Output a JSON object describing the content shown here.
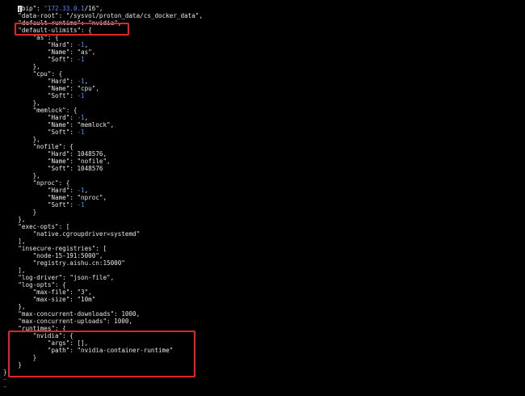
{
  "editor": {
    "lines": [
      {
        "parts": [
          {
            "t": "    "
          },
          {
            "t": "\"bip\"",
            "c": "k"
          },
          {
            "t": ": "
          },
          {
            "t": "\"172.33.0.1",
            "c": "n"
          },
          {
            "t": "/16\",",
            "c": "s"
          }
        ]
      },
      {
        "parts": [
          {
            "t": "    "
          },
          {
            "t": "\"data-root\"",
            "c": "k"
          },
          {
            "t": ": "
          },
          {
            "t": "\"/sysvol/proton_data/cs_docker_data\",",
            "c": "s"
          }
        ]
      },
      {
        "parts": [
          {
            "t": "    "
          },
          {
            "t": "\"default-runtime\"",
            "c": "k"
          },
          {
            "t": ": "
          },
          {
            "t": "\"nvidia\",",
            "c": "s"
          }
        ]
      },
      {
        "parts": [
          {
            "t": "    "
          },
          {
            "t": "\"default-ulimits\"",
            "c": "k"
          },
          {
            "t": ": {"
          }
        ]
      },
      {
        "parts": [
          {
            "t": "        "
          },
          {
            "t": "\"as\"",
            "c": "k"
          },
          {
            "t": ": {"
          }
        ]
      },
      {
        "parts": [
          {
            "t": "            "
          },
          {
            "t": "\"Hard\"",
            "c": "k"
          },
          {
            "t": ": "
          },
          {
            "t": "-1",
            "c": "n"
          },
          {
            "t": ","
          }
        ]
      },
      {
        "parts": [
          {
            "t": "            "
          },
          {
            "t": "\"Name\"",
            "c": "k"
          },
          {
            "t": ": "
          },
          {
            "t": "\"as\",",
            "c": "s"
          }
        ]
      },
      {
        "parts": [
          {
            "t": "            "
          },
          {
            "t": "\"Soft\"",
            "c": "k"
          },
          {
            "t": ": "
          },
          {
            "t": "-1",
            "c": "n"
          }
        ]
      },
      {
        "parts": [
          {
            "t": "        },"
          }
        ]
      },
      {
        "parts": [
          {
            "t": "        "
          },
          {
            "t": "\"cpu\"",
            "c": "k"
          },
          {
            "t": ": {"
          }
        ]
      },
      {
        "parts": [
          {
            "t": "            "
          },
          {
            "t": "\"Hard\"",
            "c": "k"
          },
          {
            "t": ": "
          },
          {
            "t": "-1",
            "c": "n"
          },
          {
            "t": ","
          }
        ]
      },
      {
        "parts": [
          {
            "t": "            "
          },
          {
            "t": "\"Name\"",
            "c": "k"
          },
          {
            "t": ": "
          },
          {
            "t": "\"cpu\",",
            "c": "s"
          }
        ]
      },
      {
        "parts": [
          {
            "t": "            "
          },
          {
            "t": "\"Soft\"",
            "c": "k"
          },
          {
            "t": ": "
          },
          {
            "t": "-1",
            "c": "n"
          }
        ]
      },
      {
        "parts": [
          {
            "t": "        },"
          }
        ]
      },
      {
        "parts": [
          {
            "t": "        "
          },
          {
            "t": "\"memlock\"",
            "c": "k"
          },
          {
            "t": ": {"
          }
        ]
      },
      {
        "parts": [
          {
            "t": "            "
          },
          {
            "t": "\"Hard\"",
            "c": "k"
          },
          {
            "t": ": "
          },
          {
            "t": "-1",
            "c": "n"
          },
          {
            "t": ","
          }
        ]
      },
      {
        "parts": [
          {
            "t": "            "
          },
          {
            "t": "\"Name\"",
            "c": "k"
          },
          {
            "t": ": "
          },
          {
            "t": "\"memlock\",",
            "c": "s"
          }
        ]
      },
      {
        "parts": [
          {
            "t": "            "
          },
          {
            "t": "\"Soft\"",
            "c": "k"
          },
          {
            "t": ": "
          },
          {
            "t": "-1",
            "c": "n"
          }
        ]
      },
      {
        "parts": [
          {
            "t": "        },"
          }
        ]
      },
      {
        "parts": [
          {
            "t": "        "
          },
          {
            "t": "\"nofile\"",
            "c": "k"
          },
          {
            "t": ": {"
          }
        ]
      },
      {
        "parts": [
          {
            "t": "            "
          },
          {
            "t": "\"Hard\"",
            "c": "k"
          },
          {
            "t": ": "
          },
          {
            "t": "1048576",
            "c": "d"
          },
          {
            "t": ","
          }
        ]
      },
      {
        "parts": [
          {
            "t": "            "
          },
          {
            "t": "\"Name\"",
            "c": "k"
          },
          {
            "t": ": "
          },
          {
            "t": "\"nofile\",",
            "c": "s"
          }
        ]
      },
      {
        "parts": [
          {
            "t": "            "
          },
          {
            "t": "\"Soft\"",
            "c": "k"
          },
          {
            "t": ": "
          },
          {
            "t": "1048576",
            "c": "d"
          }
        ]
      },
      {
        "parts": [
          {
            "t": "        },"
          }
        ]
      },
      {
        "parts": [
          {
            "t": "        "
          },
          {
            "t": "\"nproc\"",
            "c": "k"
          },
          {
            "t": ": {"
          }
        ]
      },
      {
        "parts": [
          {
            "t": "            "
          },
          {
            "t": "\"Hard\"",
            "c": "k"
          },
          {
            "t": ": "
          },
          {
            "t": "-1",
            "c": "n"
          },
          {
            "t": ","
          }
        ]
      },
      {
        "parts": [
          {
            "t": "            "
          },
          {
            "t": "\"Name\"",
            "c": "k"
          },
          {
            "t": ": "
          },
          {
            "t": "\"nproc\",",
            "c": "s"
          }
        ]
      },
      {
        "parts": [
          {
            "t": "            "
          },
          {
            "t": "\"Soft\"",
            "c": "k"
          },
          {
            "t": ": "
          },
          {
            "t": "-1",
            "c": "n"
          }
        ]
      },
      {
        "parts": [
          {
            "t": "        }"
          }
        ]
      },
      {
        "parts": [
          {
            "t": "    },"
          }
        ]
      },
      {
        "parts": [
          {
            "t": "    "
          },
          {
            "t": "\"exec-opts\"",
            "c": "k"
          },
          {
            "t": ": ["
          }
        ]
      },
      {
        "parts": [
          {
            "t": "        "
          },
          {
            "t": "\"native.cgroupdriver=systemd\"",
            "c": "s"
          }
        ]
      },
      {
        "parts": [
          {
            "t": "    ],"
          }
        ]
      },
      {
        "parts": [
          {
            "t": "    "
          },
          {
            "t": "\"insecure-registries\"",
            "c": "k"
          },
          {
            "t": ": ["
          }
        ]
      },
      {
        "parts": [
          {
            "t": "        "
          },
          {
            "t": "\"node-15-191:5000\",",
            "c": "s"
          }
        ]
      },
      {
        "parts": [
          {
            "t": "        "
          },
          {
            "t": "\"registry.aishu.cn:15000\"",
            "c": "s"
          }
        ]
      },
      {
        "parts": [
          {
            "t": "    ],"
          }
        ]
      },
      {
        "parts": [
          {
            "t": "    "
          },
          {
            "t": "\"log-driver\"",
            "c": "k"
          },
          {
            "t": ": "
          },
          {
            "t": "\"json-file\",",
            "c": "s"
          }
        ]
      },
      {
        "parts": [
          {
            "t": "    "
          },
          {
            "t": "\"log-opts\"",
            "c": "k"
          },
          {
            "t": ": {"
          }
        ]
      },
      {
        "parts": [
          {
            "t": "        "
          },
          {
            "t": "\"max-file\"",
            "c": "k"
          },
          {
            "t": ": "
          },
          {
            "t": "\"3\",",
            "c": "s"
          }
        ]
      },
      {
        "parts": [
          {
            "t": "        "
          },
          {
            "t": "\"max-size\"",
            "c": "k"
          },
          {
            "t": ": "
          },
          {
            "t": "\"10m\"",
            "c": "s"
          }
        ]
      },
      {
        "parts": [
          {
            "t": "    },"
          }
        ]
      },
      {
        "parts": [
          {
            "t": "    "
          },
          {
            "t": "\"max-concurrent-downloads\"",
            "c": "k"
          },
          {
            "t": ": 1000,"
          }
        ]
      },
      {
        "parts": [
          {
            "t": "    "
          },
          {
            "t": "\"max-concurrent-uploads\"",
            "c": "k"
          },
          {
            "t": ": 1000,"
          }
        ]
      },
      {
        "parts": [
          {
            "t": "    "
          },
          {
            "t": "\"runtimes\"",
            "c": "k"
          },
          {
            "t": ": {"
          }
        ]
      },
      {
        "parts": [
          {
            "t": "        "
          },
          {
            "t": "\"nvidia\"",
            "c": "k"
          },
          {
            "t": ": {"
          }
        ]
      },
      {
        "parts": [
          {
            "t": "            "
          },
          {
            "t": "\"args\"",
            "c": "k"
          },
          {
            "t": ": [],"
          }
        ]
      },
      {
        "parts": [
          {
            "t": "            "
          },
          {
            "t": "\"path\"",
            "c": "k"
          },
          {
            "t": ": "
          },
          {
            "t": "\"nvidia-container-runtime\"",
            "c": "s"
          }
        ]
      },
      {
        "parts": [
          {
            "t": "        }"
          }
        ]
      },
      {
        "parts": [
          {
            "t": "    }"
          }
        ]
      },
      {
        "parts": [
          {
            "t": "}"
          }
        ]
      },
      {
        "parts": [
          {
            "t": "~",
            "c": "tilde"
          }
        ]
      },
      {
        "parts": [
          {
            "t": "~",
            "c": "tilde"
          }
        ]
      }
    ],
    "first_line_cursor": "{"
  },
  "colors": {
    "background": "#000000",
    "text": "#e8e8e8",
    "number": "#5a88e8",
    "tilde": "#3c6fe0",
    "highlight_box": "#e0242a"
  }
}
